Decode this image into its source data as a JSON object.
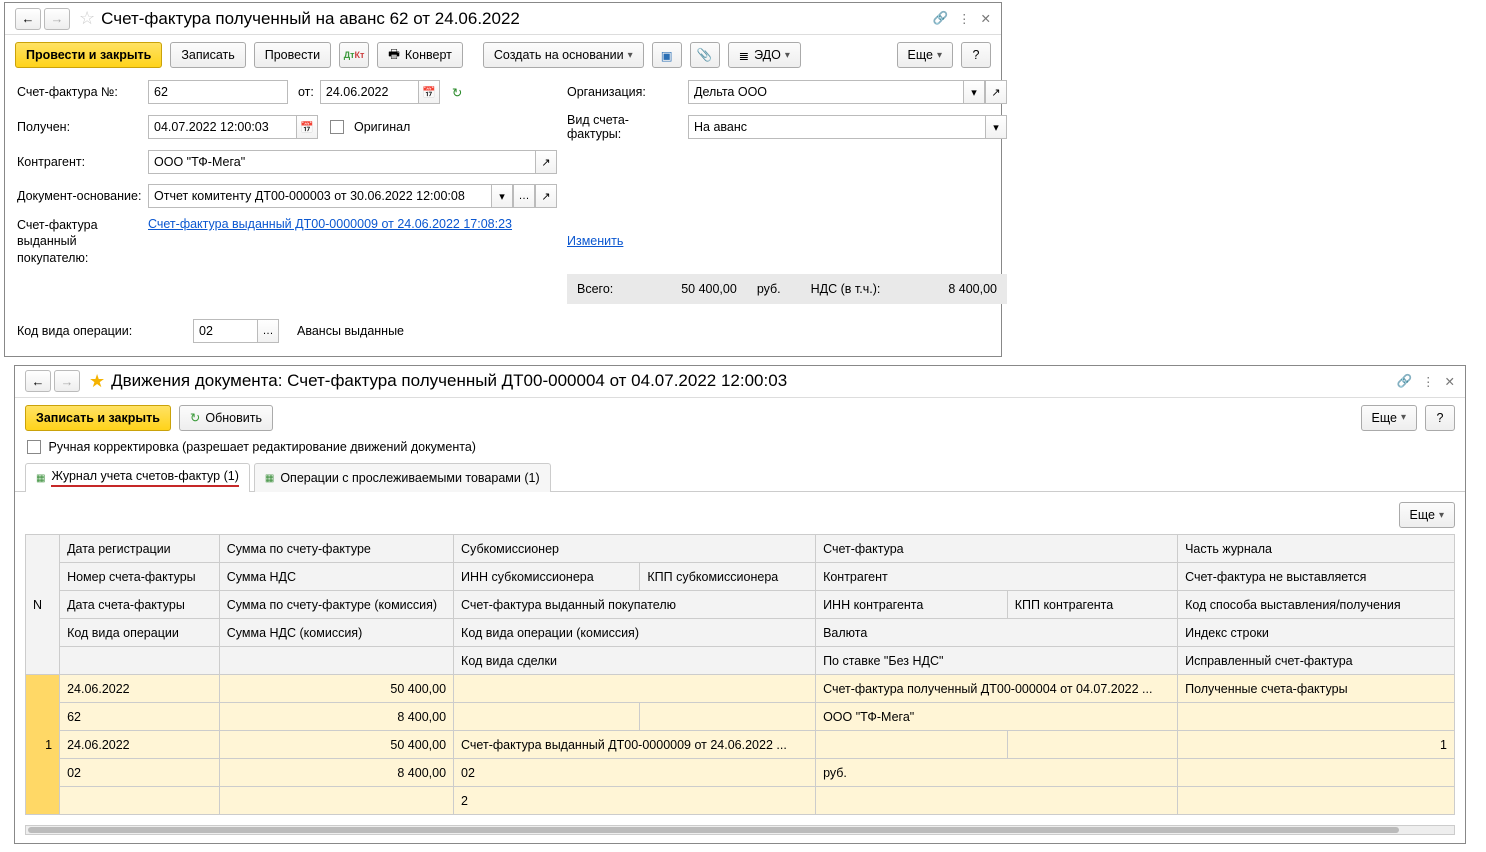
{
  "win1": {
    "title": "Счет-фактура полученный на аванс 62 от 24.06.2022",
    "btn_post_close": "Провести и закрыть",
    "btn_write": "Записать",
    "btn_post": "Провести",
    "btn_convert": "Конверт",
    "btn_create_based": "Создать на основании",
    "btn_edo": "ЭДО",
    "btn_more": "Еще",
    "lbl_sf_num": "Счет-фактура №:",
    "val_sf_num": "62",
    "lbl_from": "от:",
    "val_from": "24.06.2022",
    "lbl_received": "Получен:",
    "val_received": "04.07.2022 12:00:03",
    "lbl_original": "Оригинал",
    "lbl_counterparty": "Контрагент:",
    "val_counterparty": "ООО \"ТФ-Мега\"",
    "lbl_doc_basis": "Документ-основание:",
    "val_doc_basis": "Отчет комитенту ДТ00-000003 от 30.06.2022 12:00:08",
    "lbl_sf_out": "Счет-фактура выданный покупателю:",
    "link_sf_out": "Счет-фактура выданный ДТ00-0000009 от 24.06.2022 17:08:23",
    "link_change": "Изменить",
    "lbl_org": "Организация:",
    "val_org": "Дельта ООО",
    "lbl_sf_type": "Вид счета-фактуры:",
    "val_sf_type": "На аванс",
    "lbl_total": "Всего:",
    "val_total": "50 400,00",
    "val_currency": "руб.",
    "lbl_vat": "НДС (в т.ч.):",
    "val_vat": "8 400,00",
    "lbl_op_code": "Код вида операции:",
    "val_op_code": "02",
    "lbl_op_desc": "Авансы выданные"
  },
  "win2": {
    "title": "Движения документа: Счет-фактура полученный ДТ00-000004 от 04.07.2022 12:00:03",
    "btn_write_close": "Записать и закрыть",
    "btn_refresh": "Обновить",
    "btn_more": "Еще",
    "lbl_manual": "Ручная корректировка (разрешает редактирование движений документа)",
    "tab1": "Журнал учета счетов-фактур (1)",
    "tab2": "Операции с прослеживаемыми товарами (1)",
    "headers": {
      "n": "N",
      "c1r1": "Дата регистрации",
      "c1r2": "Номер счета-фактуры",
      "c1r3": "Дата счета-фактуры",
      "c1r4": "Код вида операции",
      "c2r1": "Сумма по счету-фактуре",
      "c2r2": "Сумма НДС",
      "c2r3": "Сумма по счету-фактуре (комиссия)",
      "c2r4": "Сумма НДС (комиссия)",
      "c3r1": "Субкомиссионер",
      "c3r2": "ИНН субкомиссионера",
      "c3r3": "Счет-фактура выданный покупателю",
      "c3r4": "Код вида операции (комиссия)",
      "c3r5": "Код вида сделки",
      "c4r2": "КПП субкомиссионера",
      "c5r1": "Счет-фактура",
      "c5r2": "Контрагент",
      "c5r3": "ИНН контрагента",
      "c5r4": "Валюта",
      "c5r5": "По ставке \"Без НДС\"",
      "c6r3": "КПП контрагента",
      "c7r1": "Часть журнала",
      "c7r2": "Счет-фактура не выставляется",
      "c7r3": "Код способа выставления/получения",
      "c7r4": "Индекс строки",
      "c7r5": "Исправленный счет-фактура"
    },
    "row": {
      "n": "1",
      "reg_date": "24.06.2022",
      "sum": "50 400,00",
      "sf": "Счет-фактура полученный ДТ00-000004 от 04.07.2022 ...",
      "part": "Полученные счета-фактуры",
      "sf_num": "62",
      "sum_vat": "8 400,00",
      "contragent": "ООО \"ТФ-Мега\"",
      "sf_date": "24.06.2022",
      "sum_comm": "50 400,00",
      "sf_out_buyer": "Счет-фактура выданный ДТ00-0000009 от 24.06.2022 ...",
      "idx": "1",
      "op_code": "02",
      "vat_comm": "8 400,00",
      "op_code_comm": "02",
      "currency": "руб.",
      "deal_code": "2"
    }
  }
}
